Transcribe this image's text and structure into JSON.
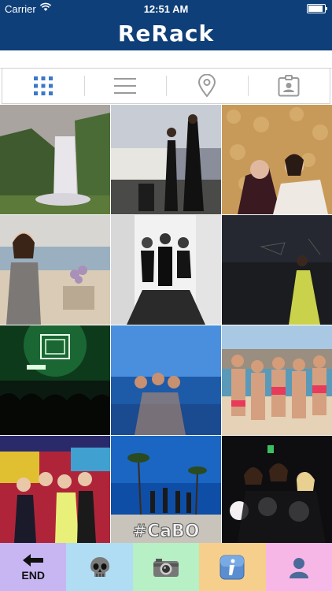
{
  "status_bar": {
    "carrier": "Carrier",
    "time": "12:51 AM",
    "battery_level": 0.9
  },
  "nav": {
    "title": "ReRack"
  },
  "tabs": [
    {
      "name": "grid-view",
      "icon": "grid-icon",
      "active": true
    },
    {
      "name": "list-view",
      "icon": "list-icon",
      "active": false
    },
    {
      "name": "map-view",
      "icon": "location-pin-icon",
      "active": false
    },
    {
      "name": "profile-view",
      "icon": "profile-badge-icon",
      "active": false
    }
  ],
  "photos": [
    {
      "subject": "waterfall landscape"
    },
    {
      "subject": "two women in black dresses by car"
    },
    {
      "subject": "two women at floral wall"
    },
    {
      "subject": "woman on beach with drink"
    },
    {
      "subject": "three women in black and white"
    },
    {
      "subject": "woman in yellow dress in dark room"
    },
    {
      "subject": "concert with green lights"
    },
    {
      "subject": "friends in infinity pool"
    },
    {
      "subject": "women in bikinis on beach"
    },
    {
      "subject": "group of women at colorful bar"
    },
    {
      "subject": "group at Cabo sign with palm trees"
    },
    {
      "subject": "women with cotton candy"
    }
  ],
  "bottom_bar": {
    "end_label": "END",
    "colors": [
      "#c7b6f2",
      "#b0ddf3",
      "#b6f0c4",
      "#f7cf8d",
      "#f7b7e6"
    ],
    "items": [
      {
        "icon": "end-arrow-icon"
      },
      {
        "icon": "skull-icon"
      },
      {
        "icon": "camera-icon"
      },
      {
        "icon": "info-icon"
      },
      {
        "icon": "person-icon"
      }
    ]
  },
  "colors": {
    "nav_background": "#0f3f78",
    "tab_active": "#3a78c9",
    "tab_inactive": "#9a9a9a"
  }
}
